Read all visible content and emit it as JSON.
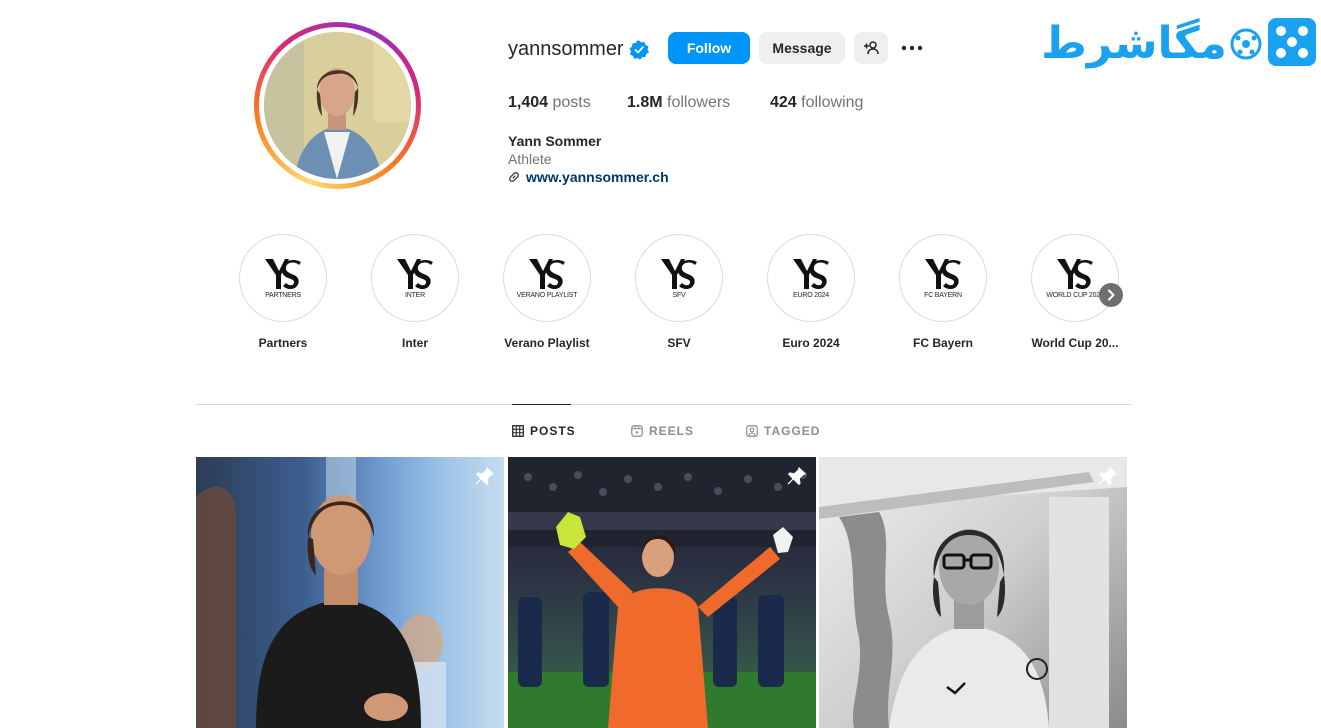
{
  "profile": {
    "username": "yannsommer",
    "follow_label": "Follow",
    "message_label": "Message",
    "add_user_icon": "add-user-icon",
    "more_icon": "more-icon",
    "stats": {
      "posts_count": "1,404",
      "posts_label": "posts",
      "followers_count": "1.8M",
      "followers_label": "followers",
      "following_count": "424",
      "following_label": "following"
    },
    "full_name": "Yann Sommer",
    "category": "Athlete",
    "website": "www.yannsommer.ch"
  },
  "highlights": [
    {
      "sub": "PARTNERS",
      "label": "Partners"
    },
    {
      "sub": "INTER",
      "label": "Inter"
    },
    {
      "sub": "VERANO PLAYLIST",
      "label": "Verano Playlist"
    },
    {
      "sub": "SFV",
      "label": "SFV"
    },
    {
      "sub": "EURO 2024",
      "label": "Euro 2024"
    },
    {
      "sub": "FC BAYERN",
      "label": "FC Bayern"
    },
    {
      "sub": "WORLD CUP 2022",
      "label": "World Cup 20..."
    }
  ],
  "highlight_logo_text": "YS",
  "tabs": {
    "posts": "POSTS",
    "reels": "REELS",
    "tagged": "TAGGED"
  },
  "watermark": {
    "text": "مگاشرط"
  },
  "colors": {
    "follow_blue": "#0095f6",
    "link_navy": "#00376b",
    "watermark_blue": "#1aa1f0"
  }
}
